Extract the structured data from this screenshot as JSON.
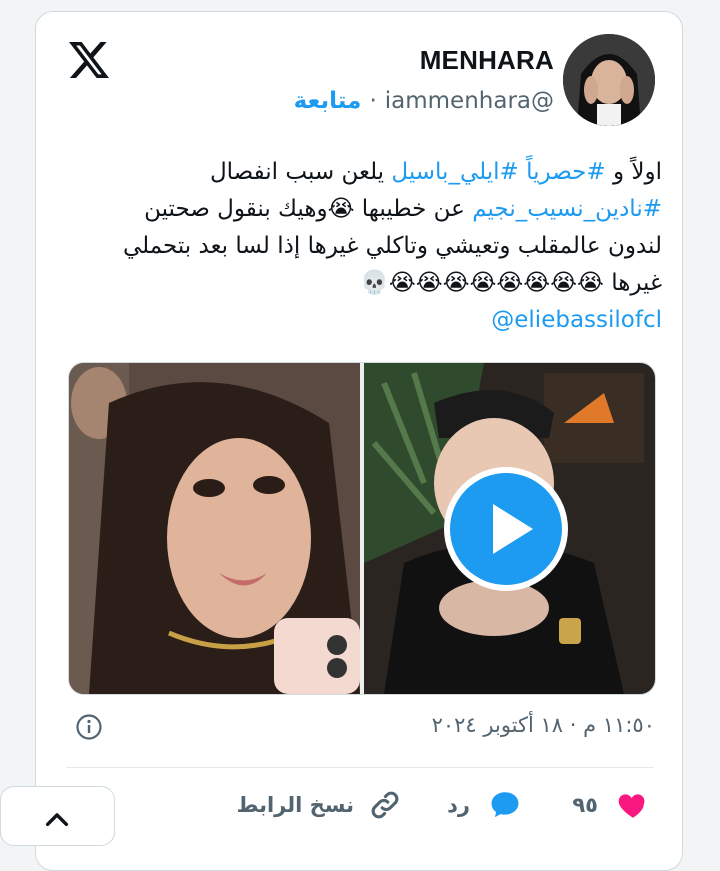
{
  "author": {
    "name": "MENHARA",
    "handle": "@iammenhara",
    "follow_label": "متابعة",
    "dot": "·"
  },
  "tweet": {
    "line1": {
      "pre": "اولاً و ",
      "tag1": "#حصرياً",
      "mid": " ",
      "tag2": "#ايلي_باسيل",
      "post": " يلعن سبب انفصال"
    },
    "line2": {
      "tag": "#نادين_نسيب_نجيم",
      "post": " عن خطيبها 😭وهيك بنقول صحتين"
    },
    "line3": "لندون عالمقلب وتعيشي وتاكلي غيرها إذا لسا بعد بتحملي",
    "line4": "غيرها 😭😭😭😭😭😭😭😭💀",
    "mention": "@eliebassilofcl"
  },
  "meta": {
    "timestamp": "١١:٥٠ م · ١٨ أكتوبر ٢٠٢٤"
  },
  "actions": {
    "likes": "٩٥",
    "reply_label": "رد",
    "copy_link_label": "نسخ الرابط"
  },
  "colors": {
    "accent": "#1d9bf0",
    "like": "#f91880",
    "muted": "#536471"
  },
  "icons": [
    "x-logo-icon",
    "info-icon",
    "heart-icon",
    "reply-icon",
    "link-icon",
    "chevron-up-icon",
    "play-icon"
  ]
}
